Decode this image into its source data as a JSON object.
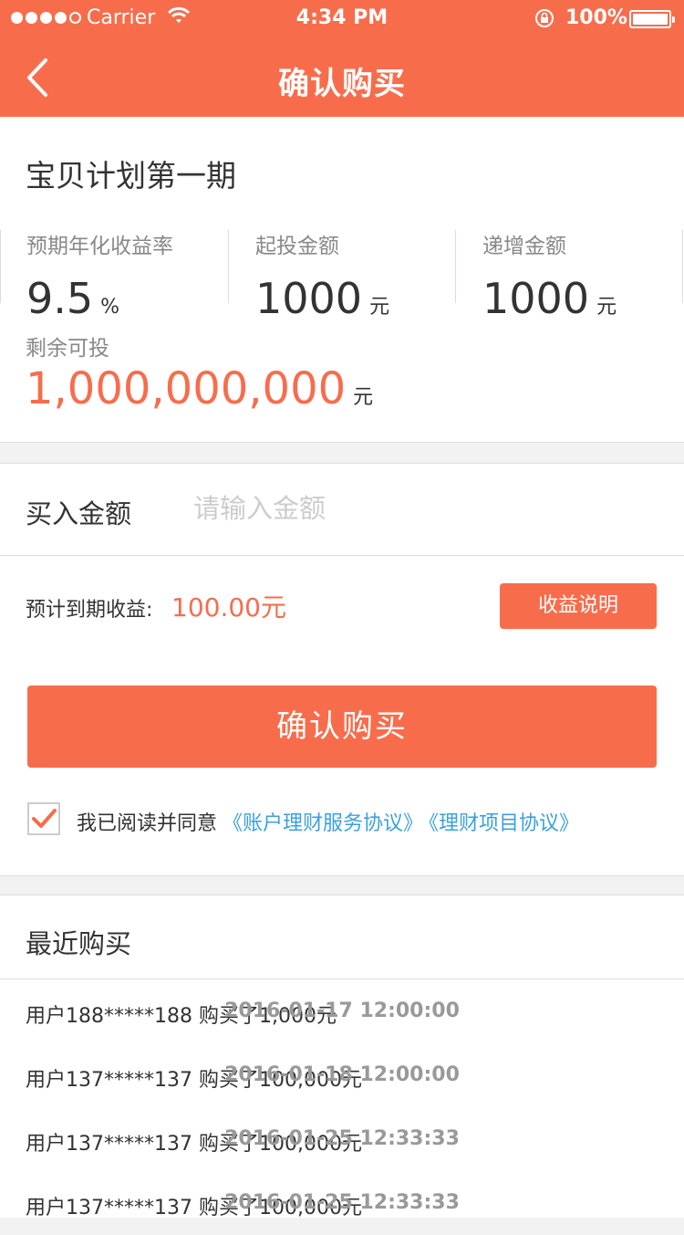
{
  "status_bar": {
    "carrier": "Carrier",
    "time": "4:34 PM",
    "battery": "100%"
  },
  "nav": {
    "title": "确认购买",
    "back_icon": "chevron-left-icon"
  },
  "product": {
    "name": "宝贝计划第一期",
    "stats": [
      {
        "label": "预期年化收益率",
        "value": "9.5",
        "unit": "%"
      },
      {
        "label": "起投金额",
        "value": "1000",
        "unit": "元"
      },
      {
        "label": "递增金额",
        "value": "1000",
        "unit": "元"
      }
    ],
    "remaining": {
      "label": "剩余可投",
      "value": "1,000,000,000",
      "unit": "元"
    }
  },
  "purchase": {
    "amount_label": "买入金额",
    "amount_placeholder": "请输入金额",
    "amount_value": "",
    "expected_label": "预计到期收益:",
    "expected_value": "100.00元",
    "explain_button": "收益说明",
    "confirm_button": "确认购买",
    "agreement": {
      "checked": true,
      "text": "我已阅读并同意",
      "link1": "《账户理财服务协议》",
      "link2": "《理财项目协议》"
    }
  },
  "recent": {
    "title": "最近购买",
    "items": [
      {
        "desc": "用户188*****188 购买了1,000元",
        "time": "2016-01-17 12:00:00"
      },
      {
        "desc": "用户137*****137 购买了100,000元",
        "time": "2016-01-18 12:00:00"
      },
      {
        "desc": "用户137*****137 购买了100,000元",
        "time": "2016-01-25 12:33:33"
      },
      {
        "desc": "用户137*****137 购买了100,000元",
        "time": "2016-01-25 12:33:33"
      }
    ]
  },
  "colors": {
    "accent": "#f76d4c",
    "link": "#3aa0e0",
    "muted": "#888888"
  }
}
